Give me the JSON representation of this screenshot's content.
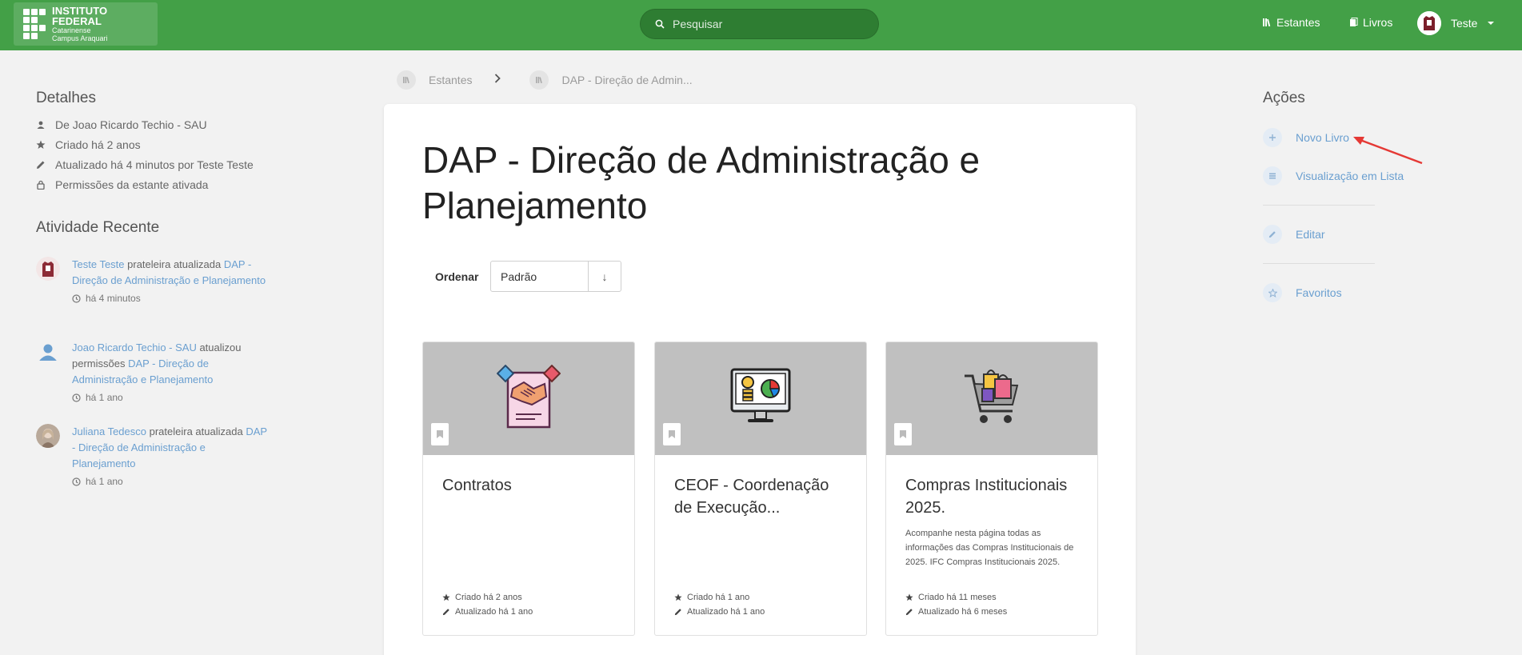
{
  "header": {
    "logo_title": "INSTITUTO FEDERAL",
    "logo_sub1": "Catarinense",
    "logo_sub2": "Campus Araquari",
    "search_placeholder": "Pesquisar",
    "nav_shelves": "Estantes",
    "nav_books": "Livros",
    "user_name": "Teste"
  },
  "colors": {
    "header_bg": "#43a047",
    "link": "#6a9fd0",
    "annotation_arrow": "#e53935"
  },
  "details": {
    "title": "Detalhes",
    "items": [
      {
        "icon": "user-icon",
        "text": "De Joao Ricardo Techio - SAU"
      },
      {
        "icon": "star-icon",
        "text": "Criado há 2 anos"
      },
      {
        "icon": "pencil-icon",
        "text": "Atualizado há 4 minutos por Teste Teste"
      },
      {
        "icon": "lock-icon",
        "text": "Permissões da estante ativada"
      }
    ]
  },
  "activity": {
    "title": "Atividade Recente",
    "items": [
      {
        "user": "Teste Teste",
        "action": " prateleira atualizada ",
        "target": "DAP - Direção de Administração e Planejamento",
        "time": "há 4 minutos"
      },
      {
        "user": "Joao Ricardo Techio - SAU",
        "action": " atualizou permissões ",
        "target": "DAP - Direção de Administração e Planejamento",
        "time": "há 1 ano"
      },
      {
        "user": "Juliana Tedesco",
        "action": " prateleira atualizada ",
        "target": "DAP - Direção de Administração e Planejamento",
        "time": "há 1 ano"
      }
    ]
  },
  "breadcrumb": {
    "root": "Estantes",
    "current": "DAP - Direção de Admin..."
  },
  "main": {
    "title": "DAP - Direção de Administração e Planejamento",
    "sort_label": "Ordenar",
    "sort_value": "Padrão",
    "sort_direction": "↓"
  },
  "books": [
    {
      "title": "Contratos",
      "description": "",
      "created": "Criado há 2 anos",
      "updated": "Atualizado há 1 ano",
      "art": "handshake-contract-icon"
    },
    {
      "title": "CEOF - Coordenação de Execução...",
      "description": "",
      "created": "Criado há 1 ano",
      "updated": "Atualizado há 1 ano",
      "art": "computer-finance-icon"
    },
    {
      "title": "Compras Institucionais 2025.",
      "description": "Acompanhe nesta página todas as informações das Compras Institucionais de 2025. IFC Compras Institucionais 2025.",
      "created": "Criado há 11 meses",
      "updated": "Atualizado há 6 meses",
      "art": "shopping-cart-icon"
    }
  ],
  "actions": {
    "title": "Ações",
    "new_book": "Novo Livro",
    "list_view": "Visualização em Lista",
    "edit": "Editar",
    "favorites": "Favoritos"
  }
}
